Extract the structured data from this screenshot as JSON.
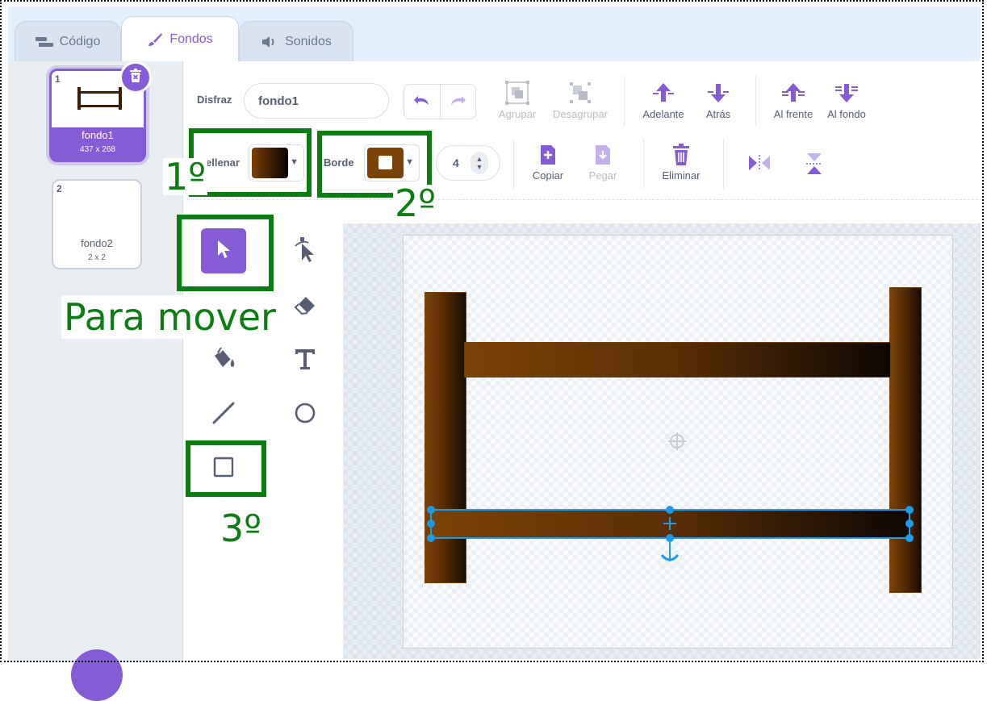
{
  "tabs": [
    {
      "label": "Código",
      "icon": "code-icon"
    },
    {
      "label": "Fondos",
      "icon": "brush-icon"
    },
    {
      "label": "Sonidos",
      "icon": "sound-icon"
    }
  ],
  "costumes": [
    {
      "number": "1",
      "name": "fondo1",
      "size": "437 x 268"
    },
    {
      "number": "2",
      "name": "fondo2",
      "size": "2 x 2"
    }
  ],
  "editor": {
    "costume_label": "Disfraz",
    "costume_name": "fondo1",
    "group_label": "Agrupar",
    "ungroup_label": "Desagrupar",
    "forward_label": "Adelante",
    "backward_label": "Atrás",
    "front_label": "Al frente",
    "back_label": "Al fondo",
    "fill_label": "ellenar",
    "outline_label": "Borde",
    "outline_width": "4",
    "copy_label": "Copiar",
    "paste_label": "Pegar",
    "delete_label": "Eliminar"
  },
  "annotations": {
    "first": "1º",
    "second": "2º",
    "third": "3º",
    "move_note": "Para mover"
  },
  "colors": {
    "accent": "#855cd6",
    "annotation_green": "#0b7d11",
    "selection_blue": "#1d9be8",
    "wood_brown": "#7a4206"
  }
}
